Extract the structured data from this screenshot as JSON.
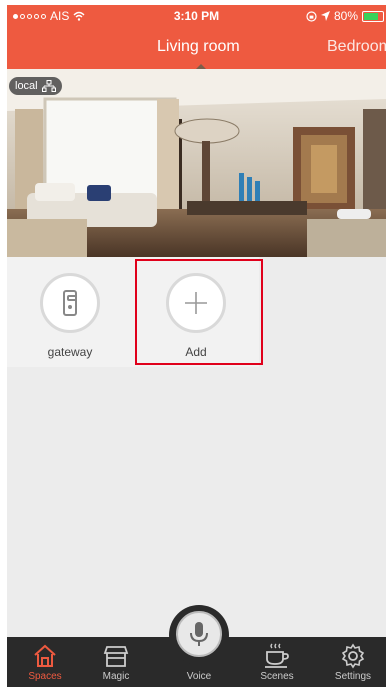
{
  "status_bar": {
    "carrier": "AIS",
    "time": "3:10 PM",
    "battery": "80%",
    "battery_level": 0.8
  },
  "header": {
    "active_room": "Living room",
    "next_room": "Bedroom"
  },
  "camera": {
    "badge": "local"
  },
  "devices": [
    {
      "label": "gateway",
      "icon": "door-lock-icon"
    },
    {
      "label": "Add",
      "icon": "plus-icon"
    }
  ],
  "tab_bar": {
    "items": [
      {
        "label": "Spaces",
        "icon": "home-icon",
        "active": true
      },
      {
        "label": "Magic",
        "icon": "store-icon"
      },
      {
        "label": "Voice",
        "icon": "microphone-icon"
      },
      {
        "label": "Scenes",
        "icon": "coffee-icon"
      },
      {
        "label": "Settings",
        "icon": "gear-icon"
      }
    ]
  },
  "colors": {
    "accent": "#ee5a40",
    "tab_bar": "#2a2a2a",
    "highlight": "#e0001b"
  }
}
